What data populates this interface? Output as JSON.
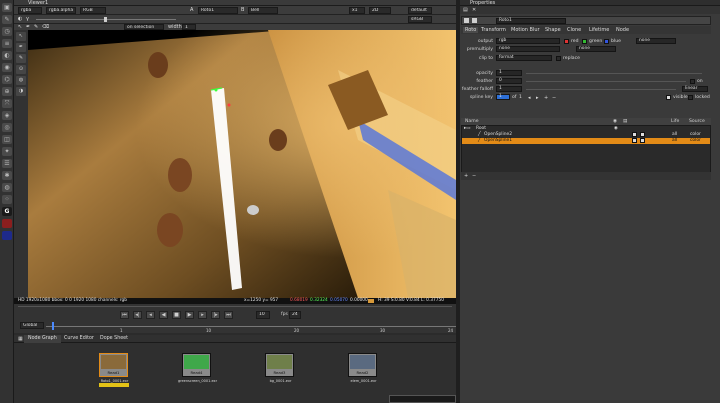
{
  "viewer": {
    "tab_title": "Viewer1",
    "channels": "rgba",
    "alpha_channel": "rgba.alpha",
    "color_space": "RGB",
    "input_a": "A",
    "input_a_value": "Roto1",
    "input_b": "B",
    "input_b_value": "Bell",
    "zoom": "x1",
    "view_mode": "2D",
    "lut": "default",
    "display": "sRGB",
    "roi_mode": "on selection",
    "width_label": "width",
    "width_value": "1"
  },
  "status_bar": {
    "format": "HD 1920x1080 bbox: 0 0 1920 1080 channels: rgb",
    "coords": "x=1250 y= 957",
    "r": "0.68019",
    "g": "0.32324",
    "b": "0.05070",
    "a": "0.00000",
    "hsvl": "H: 39 S:0.80 V:0.84 L: 0.37750"
  },
  "timeline": {
    "mode": "Global",
    "fps_label": "fps",
    "fps": "24",
    "frame": "10",
    "ticks": [
      "1",
      "10",
      "20",
      "30",
      "24"
    ]
  },
  "node_graph": {
    "tabs": [
      "Node Graph",
      "Curve Editor",
      "Dope Sheet"
    ],
    "nodes": [
      {
        "label": "Read1",
        "file": "Roto1_0001.exr",
        "thumb": "#8a6a3a"
      },
      {
        "label": "Read4",
        "file": "greenscreen_0001.exr",
        "thumb": "#3fa84a"
      },
      {
        "label": "Read3",
        "file": "bg_0001.exr",
        "thumb": "#6f7f4a"
      },
      {
        "label": "Read2",
        "file": "elem_0001.exr",
        "thumb": "#5a6a80"
      }
    ]
  },
  "properties": {
    "tab_title": "Properties",
    "node_name": "Roto1",
    "tabs": [
      "Roto",
      "Transform",
      "Motion Blur",
      "Shape",
      "Clone",
      "Lifetime",
      "Node"
    ],
    "output_label": "output",
    "output_value": "rgb",
    "channel_red": "red",
    "channel_green": "green",
    "channel_blue": "blue",
    "output_extra": "none",
    "premultiply_label": "premultiply",
    "premultiply_value": "none",
    "premultiply_extra": "none",
    "clip_to_label": "clip to",
    "clip_to_value": "format",
    "replace_label": "replace",
    "opacity_label": "opacity",
    "opacity_value": "1",
    "feather_label": "feather",
    "feather_value": "0",
    "on_label": "on",
    "feather_falloff_label": "feather falloff",
    "feather_falloff_value": "1",
    "falloff_type": "linear",
    "spline_key_label": "spline key",
    "spline_key_value": "1",
    "spline_key_of": "of",
    "spline_key_total": "1",
    "visible_label": "visible",
    "locked_label": "locked",
    "layers_header": {
      "name": "Name",
      "life": "Life",
      "source": "Source"
    },
    "layers": [
      {
        "name": "Root",
        "life": "",
        "source": ""
      },
      {
        "name": "OpenSpline2",
        "life": "all",
        "source": "color"
      },
      {
        "name": "OpenSpline1",
        "life": "all",
        "source": "color"
      }
    ]
  },
  "colors": {
    "selection": "#e38b17",
    "accent": "#e38b17"
  }
}
